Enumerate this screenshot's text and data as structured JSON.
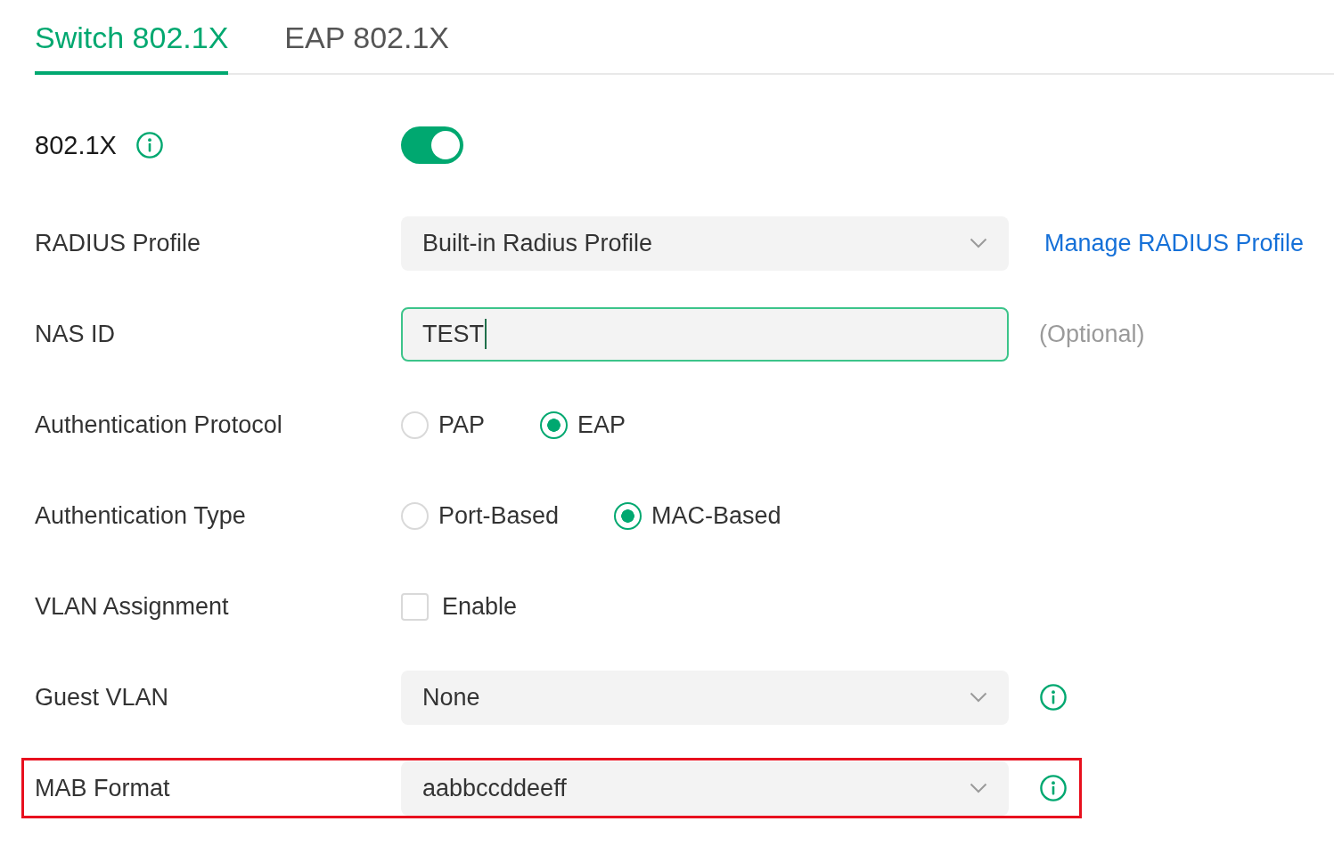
{
  "tabs": [
    {
      "label": "Switch 802.1X",
      "selected": true
    },
    {
      "label": "EAP 802.1X",
      "selected": false
    }
  ],
  "fields": [
    {
      "kind": "toggle",
      "label": "802.1X",
      "on": true,
      "info": true,
      "highlighted": false
    },
    {
      "kind": "select",
      "label": "RADIUS Profile",
      "value": "Built-in Radius Profile",
      "link": "Manage RADIUS Profile",
      "info": false,
      "highlighted": false
    },
    {
      "kind": "text",
      "label": "NAS ID",
      "value": "TEST",
      "focused": true,
      "note": "(Optional)",
      "info": false,
      "highlighted": false
    },
    {
      "kind": "radio",
      "label": "Authentication Protocol",
      "options": [
        {
          "label": "PAP",
          "selected": false
        },
        {
          "label": "EAP",
          "selected": true
        }
      ],
      "info": false,
      "highlighted": false
    },
    {
      "kind": "radio",
      "label": "Authentication Type",
      "options": [
        {
          "label": "Port-Based",
          "selected": false
        },
        {
          "label": "MAC-Based",
          "selected": true
        }
      ],
      "info": false,
      "highlighted": false
    },
    {
      "kind": "checkbox",
      "label": "VLAN Assignment",
      "checkbox_label": "Enable",
      "checked": false,
      "info": false,
      "highlighted": false
    },
    {
      "kind": "select",
      "label": "Guest VLAN",
      "value": "None",
      "info": true,
      "highlighted": false
    },
    {
      "kind": "select",
      "label": "MAB Format",
      "value": "aabbccddeeff",
      "info": true,
      "highlighted": true
    }
  ]
}
